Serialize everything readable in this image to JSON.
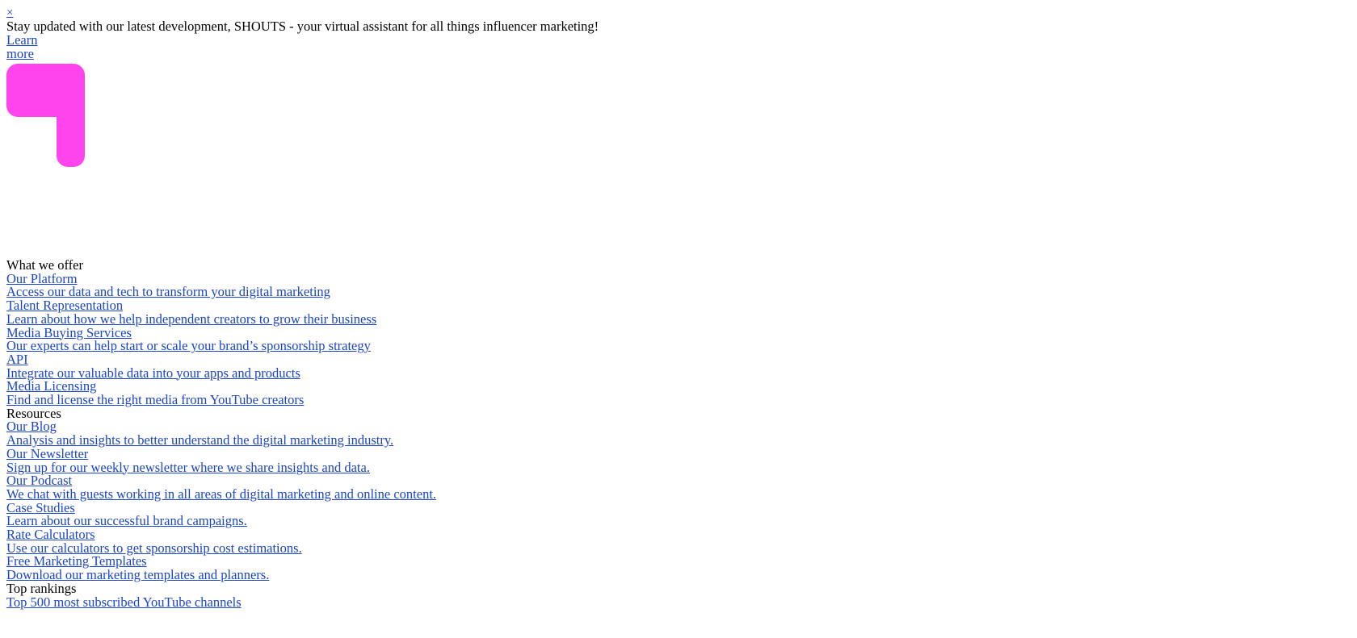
{
  "page": {
    "background_color": "#ffffff",
    "text_color": "#000000",
    "link_color": "#1a45c8"
  },
  "banner": {
    "close_label": "×",
    "message": "Stay updated with our latest development, SHOUTS - your virtual assistant for all things influencer marketing!",
    "cta_label": "Learn more"
  },
  "logo": {
    "alt": "",
    "color": "#ff44ee",
    "icon": "shouts-logo-mark"
  },
  "nav": {
    "groups": [
      {
        "title": "What we offer",
        "items": [
          {
            "label": "Our Platform",
            "description": "Access our data and tech to transform your digital marketing"
          },
          {
            "label": "Talent Representation",
            "description": "Learn about how we help independent creators to grow their business"
          },
          {
            "label": "Media Buying Services",
            "description": "Our experts can help start or scale your brand’s sponsorship strategy"
          },
          {
            "label": "API",
            "description": "Integrate our valuable data into your apps and products"
          },
          {
            "label": "Media Licensing",
            "description": "Find and license the right media from YouTube creators"
          }
        ]
      },
      {
        "title": "Resources",
        "items": [
          {
            "label": "Our Blog",
            "description": "Analysis and insights to better understand the digital marketing industry."
          },
          {
            "label": "Our Newsletter",
            "description": "Sign up for our weekly newsletter where we share insights and data."
          },
          {
            "label": "Our Podcast",
            "description": "We chat with guests working in all areas of digital marketing and online content."
          },
          {
            "label": "Case Studies",
            "description": "Learn about our successful brand campaigns."
          },
          {
            "label": "Rate Calculators",
            "description": "Use our calculators to get sponsorship cost estimations."
          },
          {
            "label": "Free Marketing Templates",
            "description": "Download our marketing templates and planners."
          }
        ]
      },
      {
        "title": "Top rankings",
        "items": [
          {
            "label": "Top 500 most subscribed YouTube channels",
            "description": ""
          }
        ]
      }
    ]
  }
}
